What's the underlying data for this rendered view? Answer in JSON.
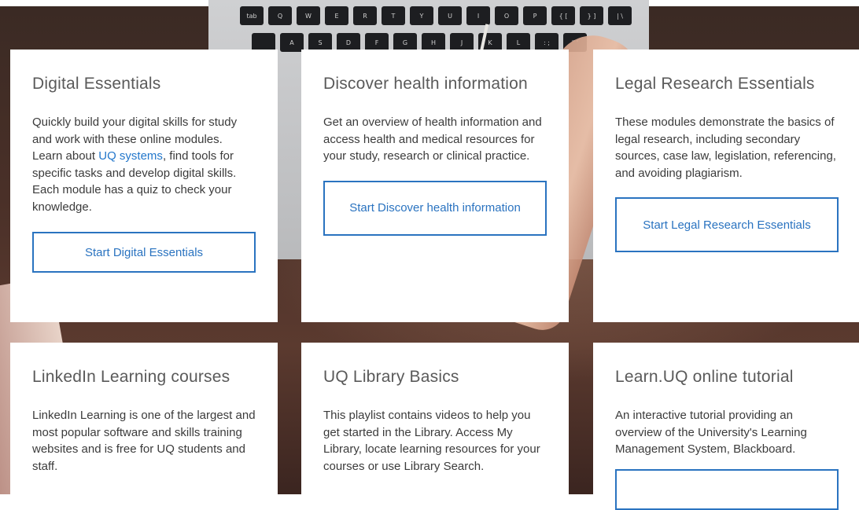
{
  "background": {
    "keyboard_rows": [
      [
        "tab",
        "Q",
        "W",
        "E",
        "R",
        "T",
        "Y",
        "U",
        "I",
        "O",
        "P",
        "{ [",
        "} ]",
        "| \\"
      ],
      [
        "",
        "A",
        "S",
        "D",
        "F",
        "G",
        "H",
        "J",
        "K",
        "L",
        ": ;",
        "\" '"
      ]
    ]
  },
  "cards": [
    {
      "title": "Digital Essentials",
      "desc_before": "Quickly build your digital skills for study and work with these online modules. Learn about ",
      "link": "UQ systems",
      "desc_after": ", find tools for specific tasks and develop digital skills. Each module has a quiz to check your knowledge.",
      "button": "Start Digital Essentials"
    },
    {
      "title": "Discover health information",
      "desc": "Get an overview of health information and access health and medical resources for your study, research or clinical practice.",
      "button": "Start Discover health information"
    },
    {
      "title": "Legal Research Essentials",
      "desc": "These modules demonstrate the basics of legal research, including secondary sources, case law, legislation, referencing, and avoiding plagiarism.",
      "button": "Start Legal Research Essentials"
    },
    {
      "title": "LinkedIn Learning courses",
      "desc": "LinkedIn Learning is one of the largest and most popular software and skills training websites and is free for UQ students and staff."
    },
    {
      "title": "UQ Library Basics",
      "desc": "This playlist contains videos to help you get started in the Library. Access My Library, locate learning resources for your courses or use Library Search."
    },
    {
      "title": "Learn.UQ online tutorial",
      "desc": "An interactive tutorial providing an overview of the University's Learning Management System, Blackboard.",
      "button": ""
    }
  ],
  "colors": {
    "link": "#2377cb",
    "button_border": "#2a73c0",
    "title": "#5a5a5a",
    "text": "#3b3b3b"
  }
}
